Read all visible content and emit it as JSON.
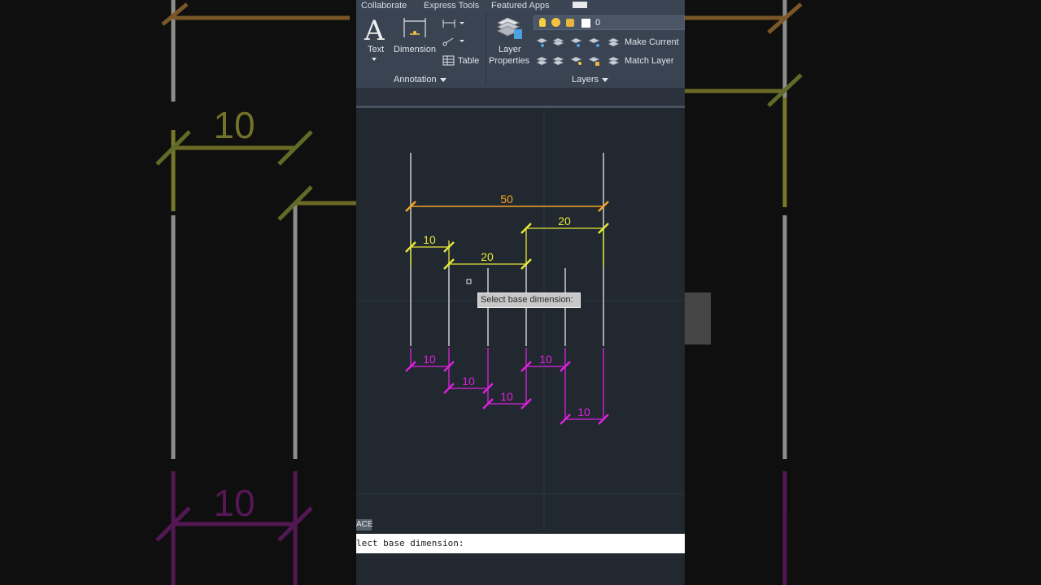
{
  "ribbon_tabs": [
    "Collaborate",
    "Express Tools",
    "Featured Apps"
  ],
  "annotation": {
    "text_label": "Text",
    "dimension_label": "Dimension",
    "table_label": "Table",
    "panel_title": "Annotation"
  },
  "layers": {
    "layer_properties_label1": "Layer",
    "layer_properties_label2": "Properties",
    "current_layer": "0",
    "make_current_label": "Make Current",
    "match_layer_label": "Match Layer",
    "panel_title": "Layers"
  },
  "drawing": {
    "overall_dimension": "50",
    "yellow_dimensions": [
      "10",
      "20",
      "20"
    ],
    "magenta_dimensions": [
      "10",
      "10",
      "10",
      "10",
      "10"
    ],
    "background_dimension": "10",
    "colors": {
      "overall": "#f5a623",
      "baseline": "#e8e83a",
      "continue": "#e020e0",
      "line": "#e8e8e8",
      "canvas": "#212830"
    }
  },
  "tooltip": "Select base dimension:",
  "space_label": "ACE",
  "command_line": "lect base dimension:"
}
